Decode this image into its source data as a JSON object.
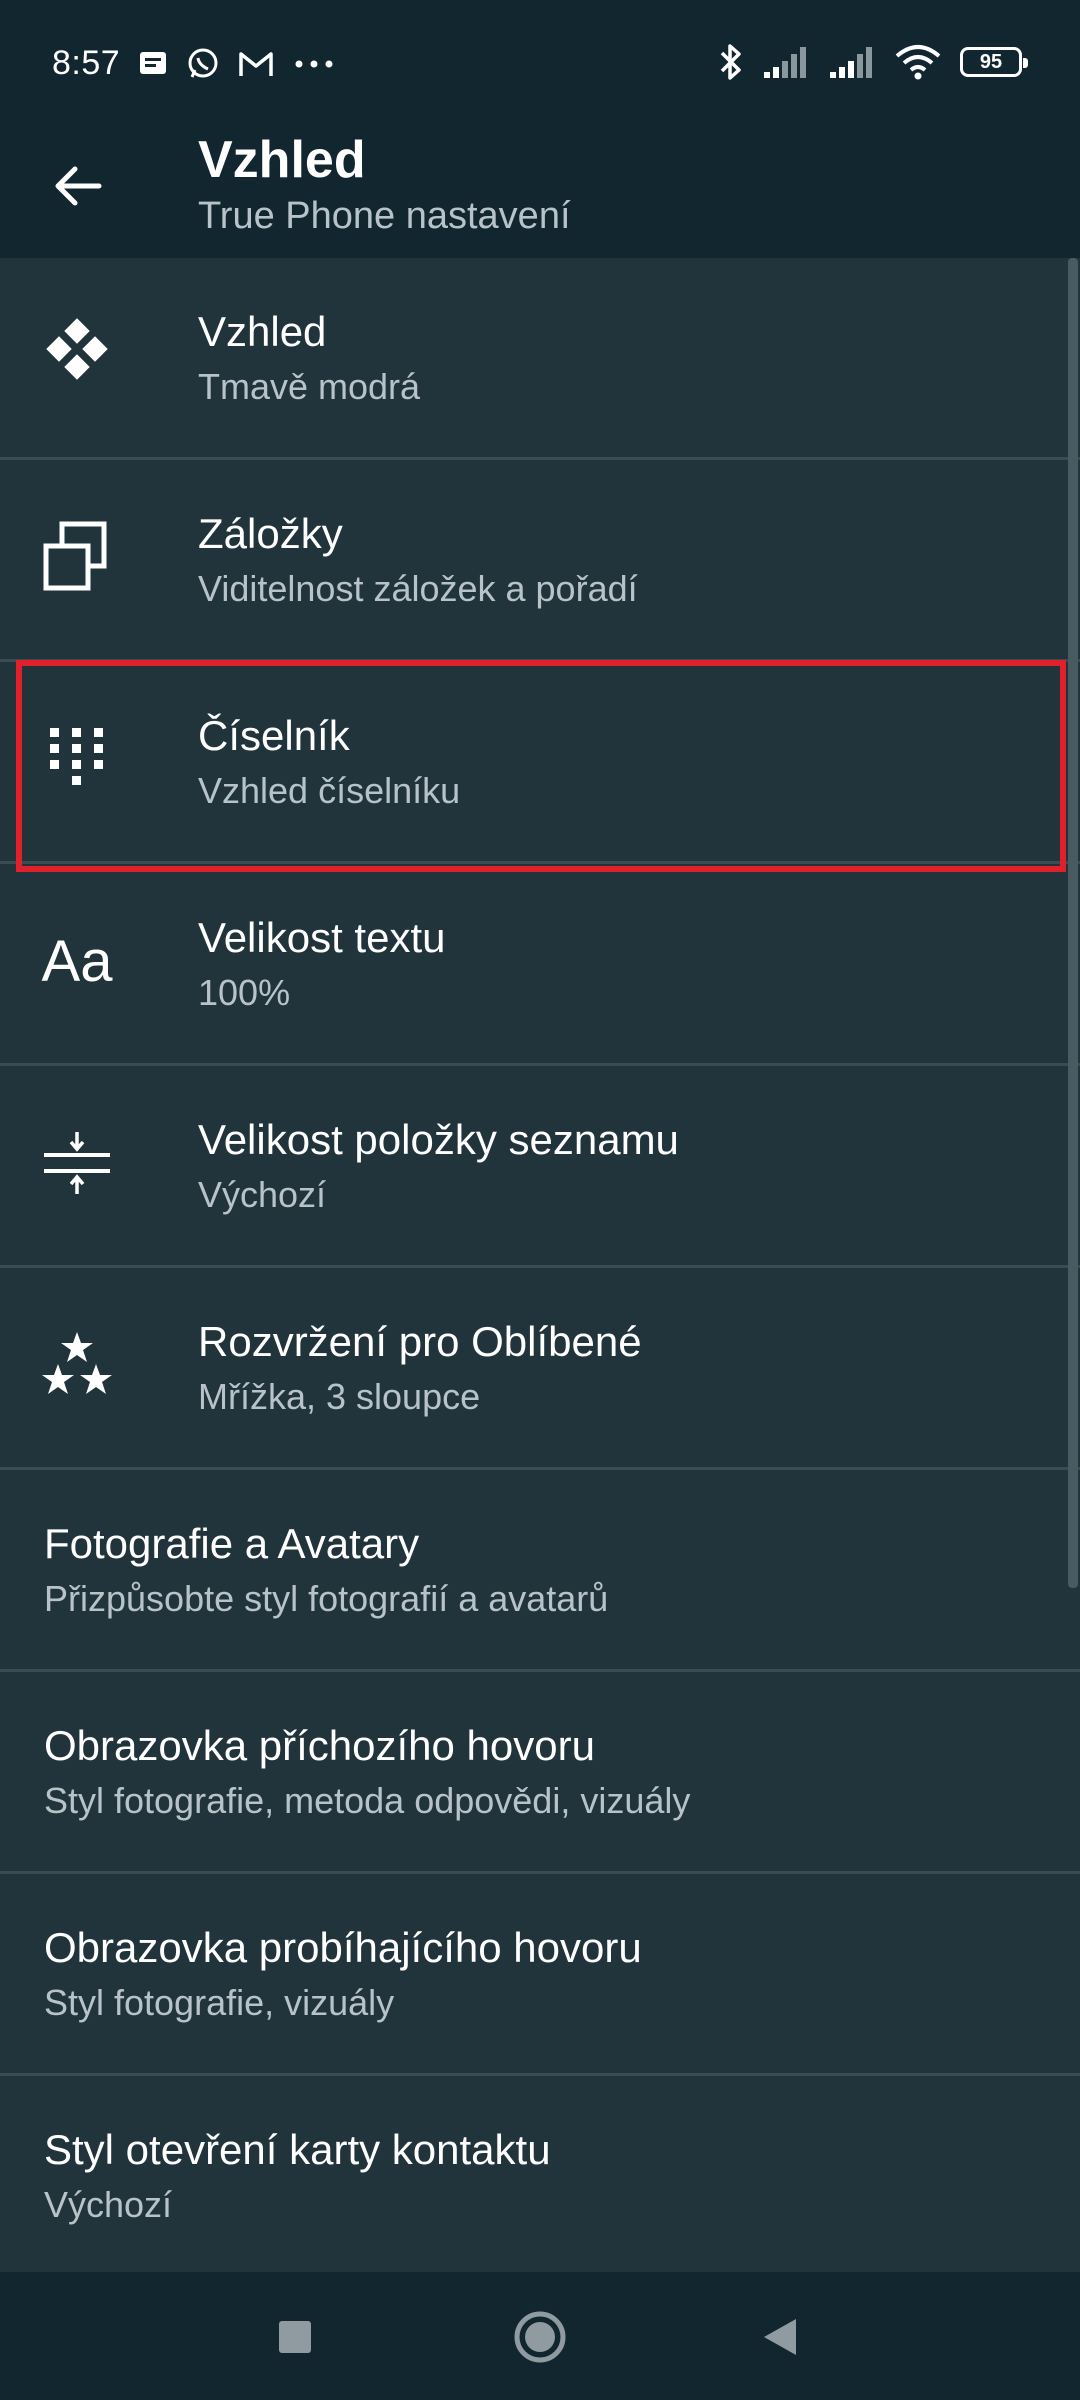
{
  "status_bar": {
    "time": "8:57",
    "battery_level": "95",
    "icons": [
      "sms-icon",
      "whatsapp-icon",
      "gmail-icon",
      "more-icon",
      "bluetooth-icon",
      "signal-icon",
      "signal-icon",
      "wifi-icon",
      "battery-icon"
    ]
  },
  "app_bar": {
    "title": "Vzhled",
    "subtitle": "True Phone nastavení"
  },
  "items": [
    {
      "title": "Vzhled",
      "subtitle": "Tmavě modrá",
      "icon": "diamond-grid-icon"
    },
    {
      "title": "Záložky",
      "subtitle": "Viditelnost záložek a pořadí",
      "icon": "tabs-icon"
    },
    {
      "title": "Číselník",
      "subtitle": "Vzhled číselníku",
      "icon": "dialpad-icon"
    },
    {
      "title": "Velikost textu",
      "subtitle": "100%",
      "icon": "text-size-icon",
      "icon_text": "Aa"
    },
    {
      "title": "Velikost položky seznamu",
      "subtitle": "Výchozí",
      "icon": "list-item-size-icon"
    },
    {
      "title": "Rozvržení pro Oblíbené",
      "subtitle": "Mřížka, 3 sloupce",
      "icon": "stars-icon"
    },
    {
      "title": "Fotografie a Avatary",
      "subtitle": "Přizpůsobte styl fotografií a avatarů"
    },
    {
      "title": "Obrazovka příchozího hovoru",
      "subtitle": "Styl fotografie, metoda odpovědi, vizuály"
    },
    {
      "title": "Obrazovka probíhajícího hovoru",
      "subtitle": "Styl fotografie, vizuály"
    },
    {
      "title": "Styl otevření karty kontaktu",
      "subtitle": "Výchozí"
    }
  ],
  "colors": {
    "background": "#22343b",
    "bar": "#12262f",
    "highlight": "#e0202a",
    "secondary_text": "#b7c3c8"
  }
}
